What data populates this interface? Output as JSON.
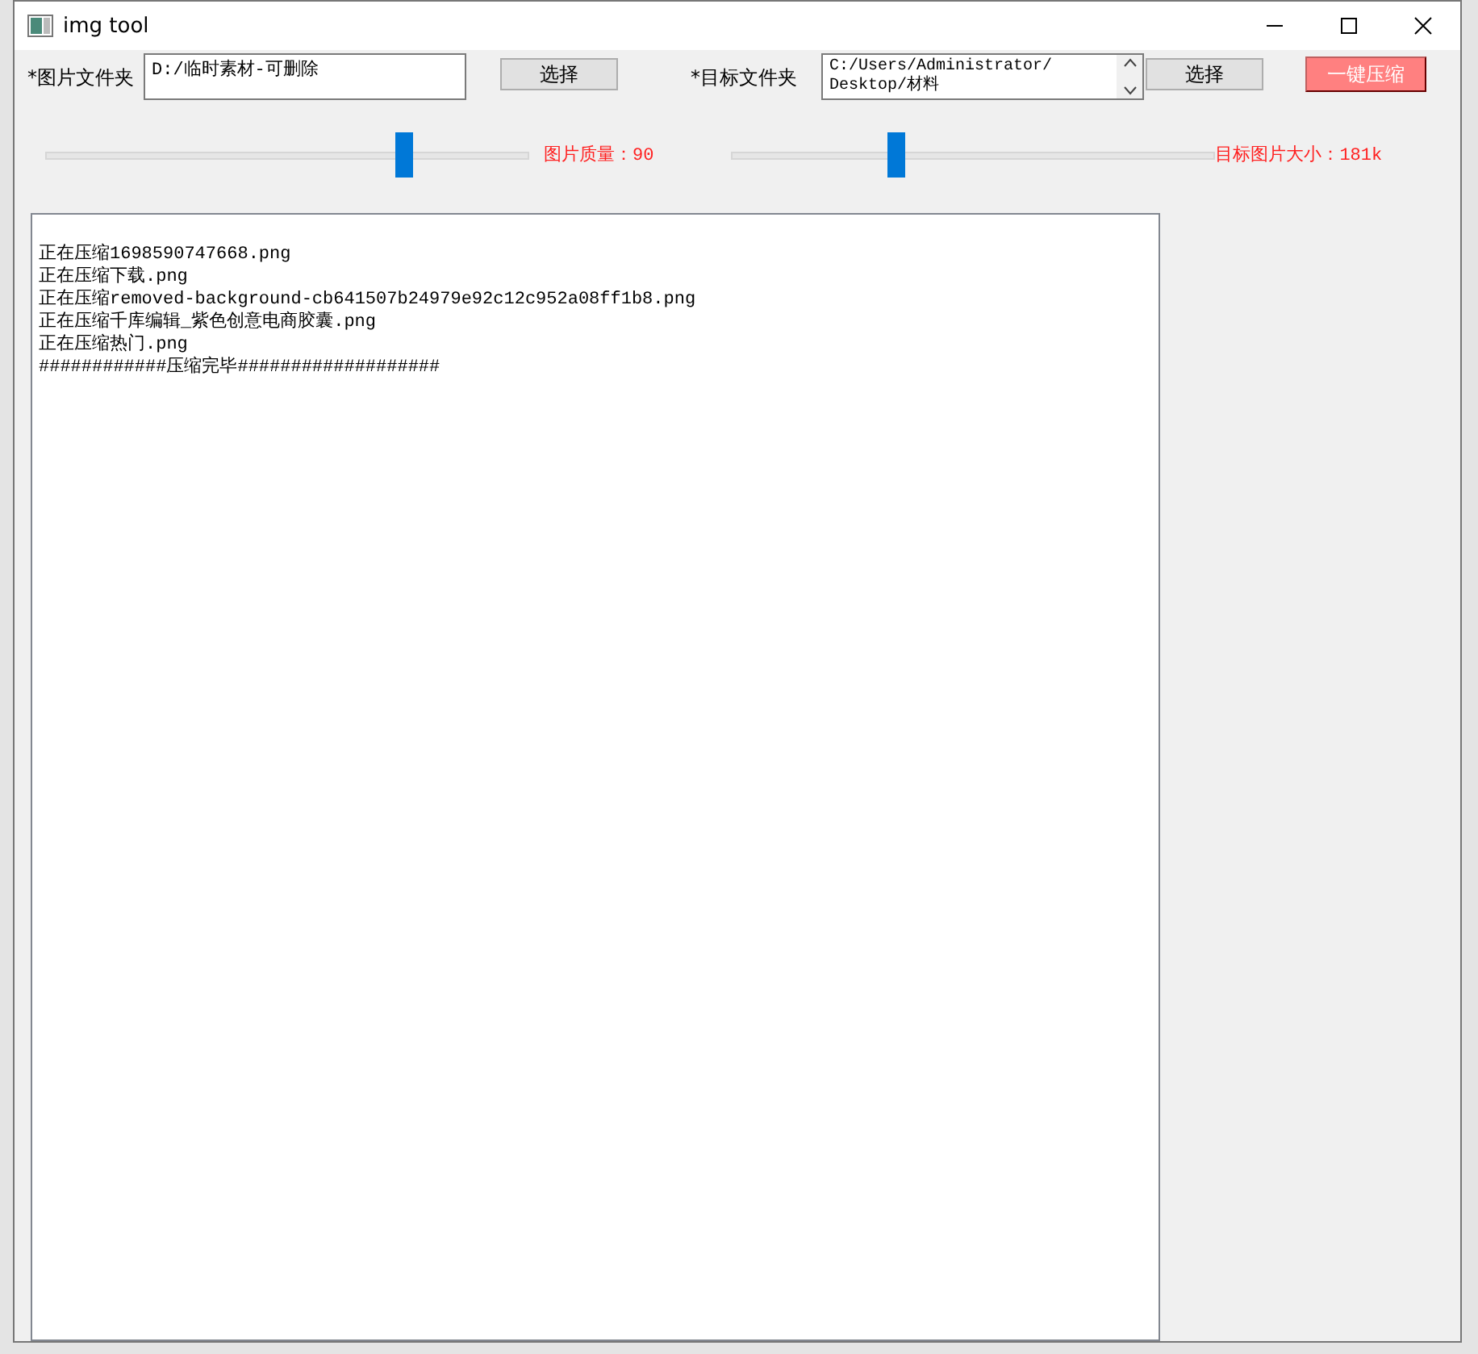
{
  "window": {
    "title": "img tool"
  },
  "source": {
    "label": "*图片文件夹",
    "value": "D:/临时素材-可删除",
    "button": "选择"
  },
  "target": {
    "label": "*目标文件夹",
    "value": "C:/Users/Administrator/\nDesktop/材料",
    "button": "选择"
  },
  "compress_button": "一键压缩",
  "sliders": [
    {
      "level": 0.74,
      "reading": "图片质量：90"
    },
    {
      "level": 0.34,
      "reading": "目标图片大小：181k"
    }
  ],
  "log": [
    "正在压缩1698590747668.png",
    "正在压缩下载.png",
    "正在压缩removed-background-cb641507b24979e92c12c952a08ff1b8.png",
    "正在压缩千库编辑_紫色创意电商胶囊.png",
    "正在压缩热门.png",
    "############压缩完毕###################"
  ]
}
